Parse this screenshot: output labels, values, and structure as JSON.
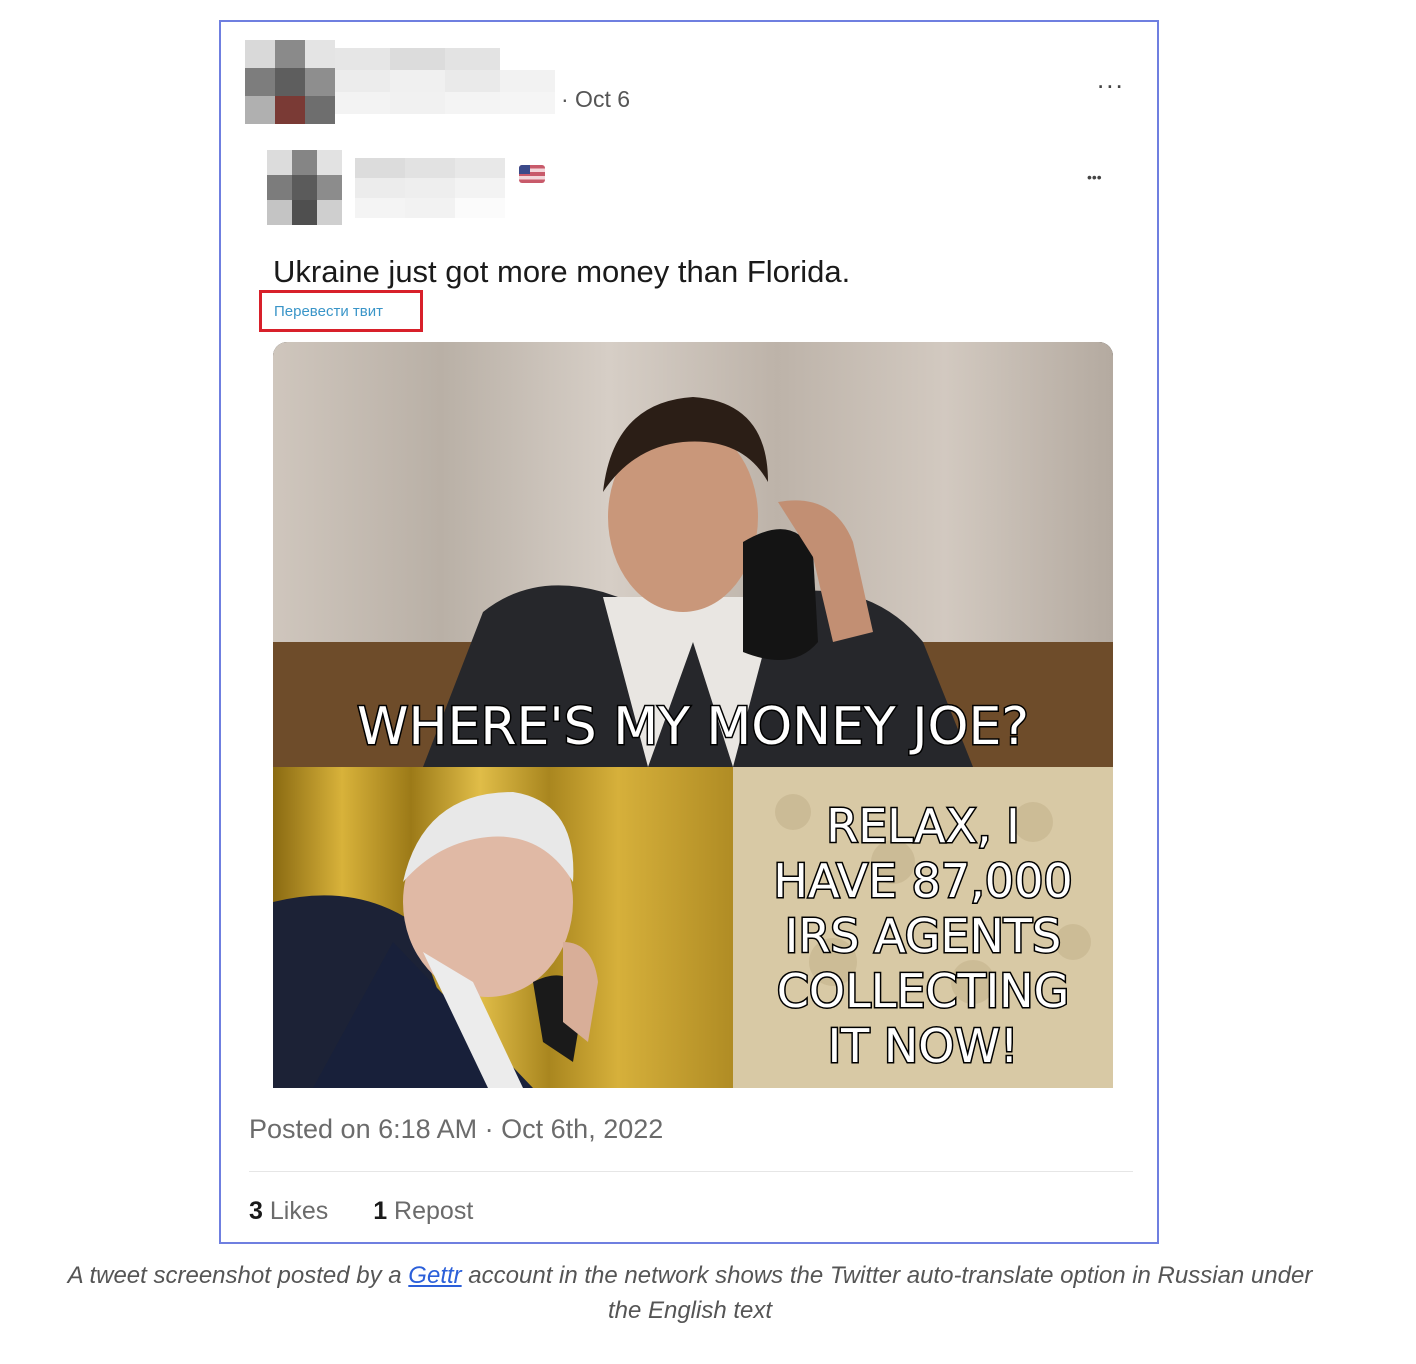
{
  "tweet": {
    "date": "· Oct 6",
    "more_label": "...",
    "quoted_more_label": "•••",
    "text": "Ukraine just got more money than Florida.",
    "translate_label": "Перевести твит",
    "meme_top_text": "WHERE'S MY MONEY JOE?",
    "meme_bottom_text": [
      "RELAX, I",
      "HAVE 87,000",
      "IRS AGENTS",
      "COLLECTING",
      "IT NOW!"
    ],
    "posted": "Posted on 6:18 AM · Oct 6th, 2022",
    "likes_count": "3",
    "likes_label": "Likes",
    "reposts_count": "1",
    "reposts_label": "Repost"
  },
  "caption": {
    "before": "A tweet screenshot posted by a ",
    "link": "Gettr",
    "after": " account in the network shows the Twitter auto-translate option in Russian under the English text"
  },
  "colors": {
    "frame": "#6f7fe0",
    "highlight": "#d8202a",
    "link": "#2b5fd9"
  }
}
